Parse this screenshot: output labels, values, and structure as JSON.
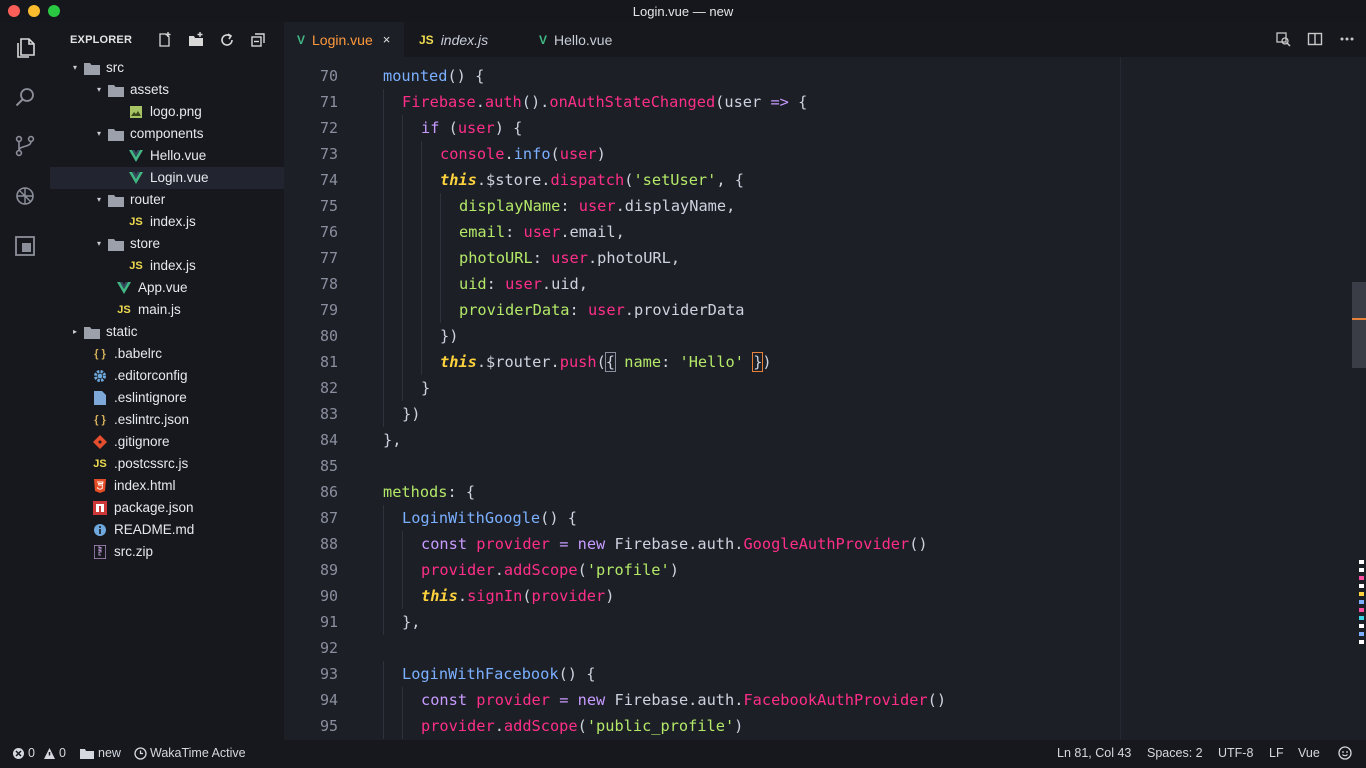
{
  "window": {
    "title": "Login.vue — new"
  },
  "sidebar": {
    "title": "EXPLORER",
    "tree": [
      {
        "label": "src",
        "type": "folder",
        "open": true,
        "depth": 0
      },
      {
        "label": "assets",
        "type": "folder",
        "open": true,
        "depth": 1
      },
      {
        "label": "logo.png",
        "type": "image",
        "depth": 2
      },
      {
        "label": "components",
        "type": "folder",
        "open": true,
        "depth": 1
      },
      {
        "label": "Hello.vue",
        "type": "vue",
        "depth": 2
      },
      {
        "label": "Login.vue",
        "type": "vue",
        "depth": 2,
        "selected": true
      },
      {
        "label": "router",
        "type": "folder",
        "open": true,
        "depth": 1
      },
      {
        "label": "index.js",
        "type": "js",
        "depth": 2
      },
      {
        "label": "store",
        "type": "folder",
        "open": true,
        "depth": 1
      },
      {
        "label": "index.js",
        "type": "js",
        "depth": 2
      },
      {
        "label": "App.vue",
        "type": "vue",
        "depth": 1.5
      },
      {
        "label": "main.js",
        "type": "js",
        "depth": 1.5
      },
      {
        "label": "static",
        "type": "folder",
        "open": false,
        "depth": 0
      },
      {
        "label": ".babelrc",
        "type": "braces",
        "depth": 0.5
      },
      {
        "label": ".editorconfig",
        "type": "gear",
        "depth": 0.5
      },
      {
        "label": ".eslintignore",
        "type": "doc",
        "depth": 0.5
      },
      {
        "label": ".eslintrc.json",
        "type": "braces",
        "depth": 0.5
      },
      {
        "label": ".gitignore",
        "type": "git",
        "depth": 0.5
      },
      {
        "label": ".postcssrc.js",
        "type": "js",
        "depth": 0.5
      },
      {
        "label": "index.html",
        "type": "html",
        "depth": 0.5
      },
      {
        "label": "package.json",
        "type": "npm",
        "depth": 0.5
      },
      {
        "label": "README.md",
        "type": "info",
        "depth": 0.5
      },
      {
        "label": "src.zip",
        "type": "zip",
        "depth": 0.5
      }
    ]
  },
  "tabs": [
    {
      "label": "Login.vue",
      "icon": "V",
      "active": true,
      "close": "×"
    },
    {
      "label": "index.js",
      "icon": "JS",
      "active": false
    },
    {
      "label": "Hello.vue",
      "icon": "V",
      "active": false
    }
  ],
  "editor": {
    "lines": [
      {
        "n": "70",
        "indent": 0,
        "html": "<span class=\"m\">mounted</span>() {"
      },
      {
        "n": "71",
        "indent": 1,
        "html": "<span class=\"fn\">Firebase</span>.<span class=\"fn\">auth</span>().<span class=\"fn\">onAuthStateChanged</span>(user <span class=\"kw\">=&gt;</span> {"
      },
      {
        "n": "72",
        "indent": 2,
        "html": "<span class=\"kw\">if</span> (<span class=\"fn\">user</span>) {"
      },
      {
        "n": "73",
        "indent": 3,
        "html": "<span class=\"fn\">console</span>.<span class=\"m\">info</span>(<span class=\"fn\">user</span>)"
      },
      {
        "n": "74",
        "indent": 3,
        "html": "<span class=\"t\">this</span>.$store.<span class=\"fn\">dispatch</span>(<span class=\"s\">'setUser'</span>, {"
      },
      {
        "n": "75",
        "indent": 4,
        "html": "<span class=\"p\">displayName</span>: <span class=\"fn\">user</span>.displayName,"
      },
      {
        "n": "76",
        "indent": 4,
        "html": "<span class=\"p\">email</span>: <span class=\"fn\">user</span>.email,"
      },
      {
        "n": "77",
        "indent": 4,
        "html": "<span class=\"p\">photoURL</span>: <span class=\"fn\">user</span>.photoURL,"
      },
      {
        "n": "78",
        "indent": 4,
        "html": "<span class=\"p\">uid</span>: <span class=\"fn\">user</span>.uid,"
      },
      {
        "n": "79",
        "indent": 4,
        "html": "<span class=\"p\">providerData</span>: <span class=\"fn\">user</span>.providerData"
      },
      {
        "n": "80",
        "indent": 3,
        "html": "})"
      },
      {
        "n": "81",
        "indent": 3,
        "html": "<span class=\"t\">this</span>.$router.<span class=\"fn\">push</span>(<span style=\"outline:1px solid #8a8f9e\">{</span> <span class=\"p\">name</span>: <span class=\"s\">'Hello'</span> <span style=\"outline:1px solid #e8813a\">}</span>)"
      },
      {
        "n": "82",
        "indent": 2,
        "html": "}"
      },
      {
        "n": "83",
        "indent": 1,
        "html": "})"
      },
      {
        "n": "84",
        "indent": 0,
        "html": "},"
      },
      {
        "n": "85",
        "indent": 0,
        "html": ""
      },
      {
        "n": "86",
        "indent": 0,
        "html": "<span class=\"p\">methods</span>: {"
      },
      {
        "n": "87",
        "indent": 1,
        "html": "<span class=\"m\">LoginWithGoogle</span>() {"
      },
      {
        "n": "88",
        "indent": 2,
        "html": "<span class=\"kw\">const</span> <span class=\"fn\">provider</span> <span class=\"kw\">=</span> <span class=\"kw\">new</span> <span class=\"pu\">Firebase</span>.auth.<span class=\"fn\">GoogleAuthProvider</span>()"
      },
      {
        "n": "89",
        "indent": 2,
        "html": "<span class=\"fn\">provider</span>.<span class=\"fn\">addScope</span>(<span class=\"s\">'profile'</span>)"
      },
      {
        "n": "90",
        "indent": 2,
        "html": "<span class=\"t\">this</span>.<span class=\"fn\">signIn</span>(<span class=\"fn\">provider</span>)"
      },
      {
        "n": "91",
        "indent": 1,
        "html": "},"
      },
      {
        "n": "92",
        "indent": 0,
        "html": ""
      },
      {
        "n": "93",
        "indent": 1,
        "html": "<span class=\"m\">LoginWithFacebook</span>() {"
      },
      {
        "n": "94",
        "indent": 2,
        "html": "<span class=\"kw\">const</span> <span class=\"fn\">provider</span> <span class=\"kw\">=</span> <span class=\"kw\">new</span> <span class=\"pu\">Firebase</span>.auth.<span class=\"fn\">FacebookAuthProvider</span>()"
      },
      {
        "n": "95",
        "indent": 2,
        "html": "<span class=\"fn\">provider</span>.<span class=\"fn\">addScope</span>(<span class=\"s\">'public_profile'</span>)"
      }
    ]
  },
  "status": {
    "errors": "0",
    "warnings": "0",
    "folder": "new",
    "wakatime": "WakaTime Active",
    "position": "Ln 81, Col 43",
    "spaces": "Spaces: 2",
    "encoding": "UTF-8",
    "eol": "LF",
    "language": "Vue"
  },
  "colors": {
    "accent": "#e8813a",
    "vue_green": "#41b883",
    "js_yellow": "#f0db4f"
  }
}
